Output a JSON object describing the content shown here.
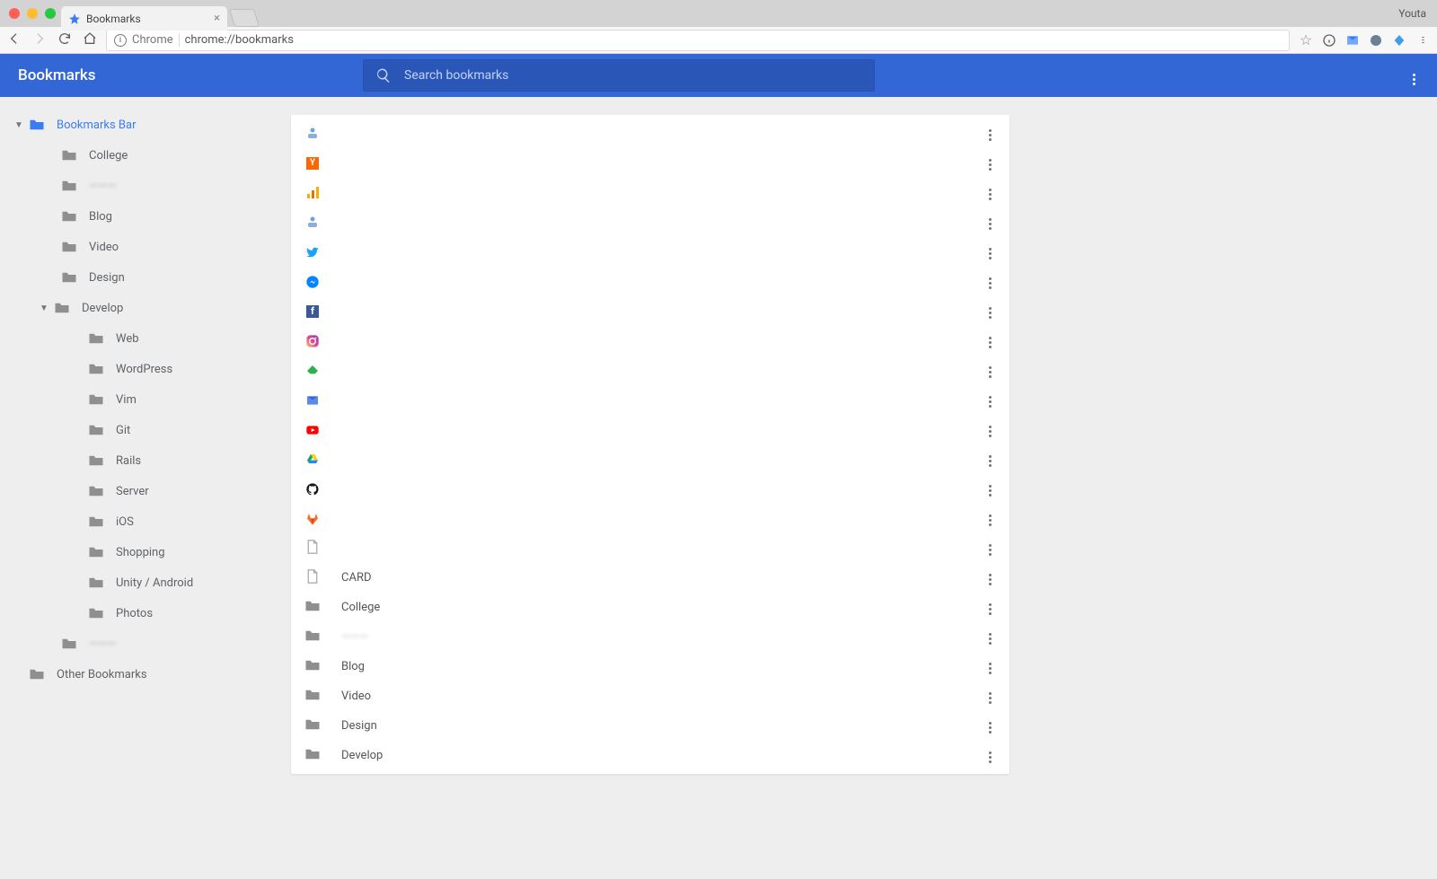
{
  "os": {
    "profile": "Youta"
  },
  "browser": {
    "tab_title": "Bookmarks",
    "omnibox_chip": "Chrome",
    "omnibox_url": "chrome://bookmarks"
  },
  "header": {
    "title": "Bookmarks",
    "search_placeholder": "Search bookmarks"
  },
  "sidebar": {
    "root": "Bookmarks Bar",
    "other": "Other Bookmarks",
    "folders": [
      {
        "label": "College",
        "depth": 2
      },
      {
        "label": "———",
        "depth": 2,
        "blur": true
      },
      {
        "label": "Blog",
        "depth": 2
      },
      {
        "label": "Video",
        "depth": 2
      },
      {
        "label": "Design",
        "depth": 2
      },
      {
        "label": "Develop",
        "depth": 2,
        "expand": true
      },
      {
        "label": "Web",
        "depth": 3
      },
      {
        "label": "WordPress",
        "depth": 3
      },
      {
        "label": "Vim",
        "depth": 3
      },
      {
        "label": "Git",
        "depth": 3
      },
      {
        "label": "Rails",
        "depth": 3
      },
      {
        "label": "Server",
        "depth": 3
      },
      {
        "label": "iOS",
        "depth": 3
      },
      {
        "label": "Shopping",
        "depth": 3
      },
      {
        "label": "Unity / Android",
        "depth": 3
      },
      {
        "label": "Photos",
        "depth": 3
      },
      {
        "label": "———",
        "depth": 2,
        "blur": true
      }
    ]
  },
  "list": [
    {
      "icon": "site-generic",
      "title": "",
      "kind": "link"
    },
    {
      "icon": "hn",
      "title": "",
      "kind": "link"
    },
    {
      "icon": "analytics",
      "title": "",
      "kind": "link"
    },
    {
      "icon": "site-generic",
      "title": "",
      "kind": "link"
    },
    {
      "icon": "twitter",
      "title": "",
      "kind": "link"
    },
    {
      "icon": "messenger",
      "title": "",
      "kind": "link"
    },
    {
      "icon": "facebook",
      "title": "",
      "kind": "link"
    },
    {
      "icon": "instagram",
      "title": "",
      "kind": "link"
    },
    {
      "icon": "feedly",
      "title": "",
      "kind": "link"
    },
    {
      "icon": "inbox",
      "title": "",
      "kind": "link"
    },
    {
      "icon": "youtube",
      "title": "",
      "kind": "link"
    },
    {
      "icon": "drive",
      "title": "",
      "kind": "link"
    },
    {
      "icon": "github",
      "title": "",
      "kind": "link"
    },
    {
      "icon": "gitlab",
      "title": "",
      "kind": "link"
    },
    {
      "icon": "doc",
      "title": "",
      "kind": "link"
    },
    {
      "icon": "doc",
      "title": "CARD",
      "kind": "link"
    },
    {
      "icon": "folder",
      "title": "College",
      "kind": "folder"
    },
    {
      "icon": "folder",
      "title": "———",
      "kind": "folder",
      "blur": true
    },
    {
      "icon": "folder",
      "title": "Blog",
      "kind": "folder"
    },
    {
      "icon": "folder",
      "title": "Video",
      "kind": "folder"
    },
    {
      "icon": "folder",
      "title": "Design",
      "kind": "folder"
    },
    {
      "icon": "folder",
      "title": "Develop",
      "kind": "folder"
    }
  ]
}
